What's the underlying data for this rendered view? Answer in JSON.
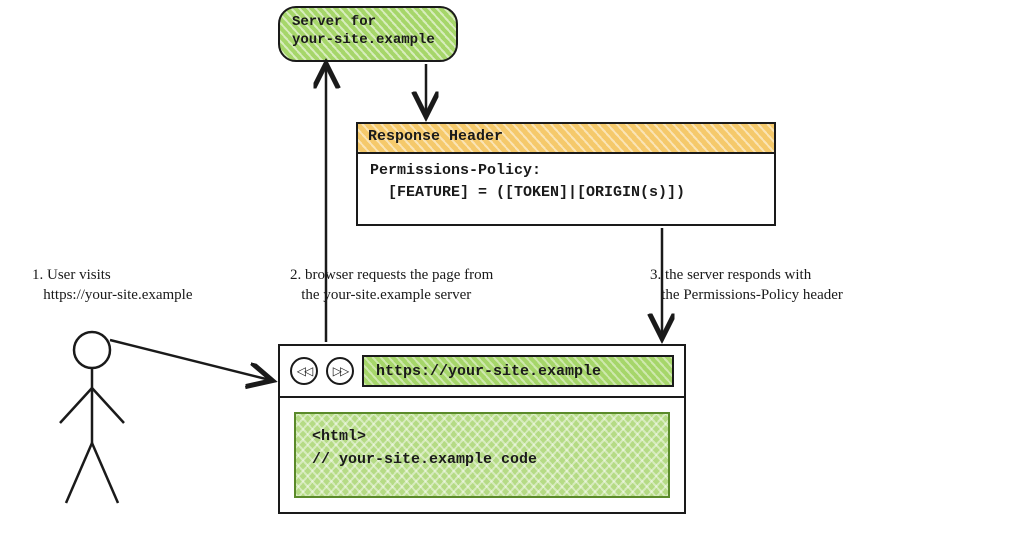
{
  "server": {
    "line1": "Server for",
    "line2": "your-site.example"
  },
  "response_header": {
    "title": "Response Header",
    "line1": "Permissions-Policy:",
    "line2": "  [FEATURE] = ([TOKEN]|[ORIGIN(s)])"
  },
  "browser": {
    "back_glyph": "◁◁",
    "fwd_glyph": "▷▷",
    "url": "https://your-site.example",
    "code_line1": "<html>",
    "code_line2": "// your-site.example code"
  },
  "steps": {
    "s1a": "1. User visits",
    "s1b": "   https://your-site.example",
    "s2a": "2. browser requests the page from",
    "s2b": "   the your-site.example server",
    "s3a": "3. the server responds with",
    "s3b": "   the Permissions-Policy header"
  }
}
